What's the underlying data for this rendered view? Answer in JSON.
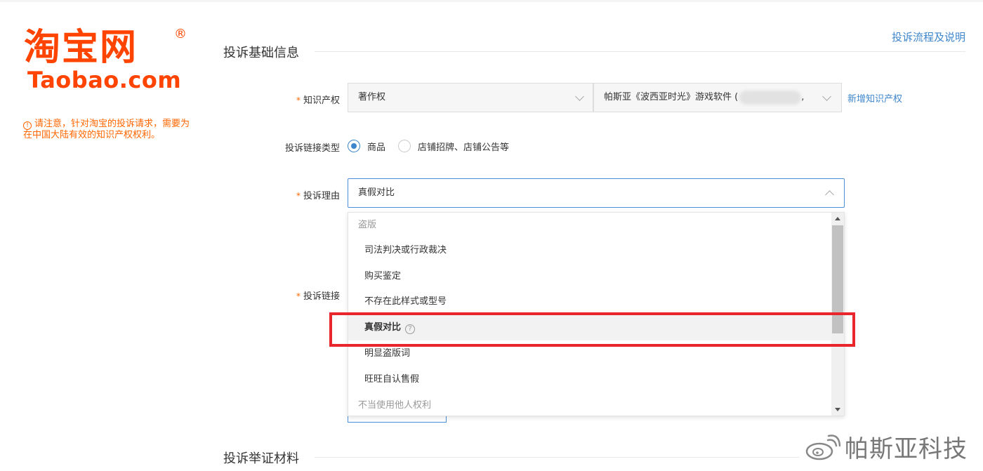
{
  "logo": {
    "cn": "淘宝网",
    "reg": "®",
    "en": "Taobao.com"
  },
  "notice": {
    "icon": "!",
    "text": "请注意，针对淘宝的投诉请求，需要为在中国大陆有效的知识产权权利。"
  },
  "help_link": "投诉流程及说明",
  "section1_title": "投诉基础信息",
  "section2_title": "投诉举证材料",
  "ip": {
    "label": "知识产权",
    "required": "*",
    "type_value": "著作权",
    "right_value": "帕斯亚《波西亚时光》游戏软件 (",
    "right_suffix": ",",
    "add_link": "新增知识产权"
  },
  "link_type": {
    "label": "投诉链接类型",
    "options": [
      "商品",
      "店铺招牌、店铺公告等"
    ],
    "selected_index": 0
  },
  "reason": {
    "label": "投诉理由",
    "required": "*",
    "value": "真假对比"
  },
  "complaint_link": {
    "label": "投诉链接",
    "required": "*"
  },
  "dropdown": {
    "groups": [
      "盗版",
      "不当使用他人权利"
    ],
    "items": [
      "司法判决或行政裁决",
      "购买鉴定",
      "不存在此样式或型号",
      "真假对比",
      "明显盗版词",
      "旺旺自认售假"
    ],
    "active_item": "真假对比",
    "help_mark": "?"
  },
  "watermark": {
    "text": "帕斯亚科技"
  },
  "colors": {
    "brand": "#ff4400",
    "link": "#3d86cc",
    "notice": "#ff6600",
    "highlight": "#e8262b"
  }
}
